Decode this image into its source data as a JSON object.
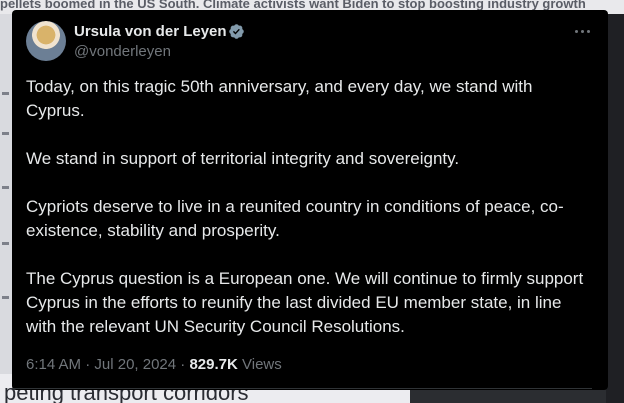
{
  "background": {
    "headline": "pellets boomed in the US South. Climate activists want Biden to stop boosting industry growth",
    "bottom_text": "peting transport corridors"
  },
  "tweet": {
    "author": {
      "name": "Ursula von der Leyen",
      "handle": "@vonderleyen",
      "verified": true
    },
    "paragraphs": [
      "Today, on this tragic 50th anniversary, and every day, we stand with Cyprus.",
      "We stand in support of territorial integrity and sovereignty.",
      "Cypriots deserve to live in a reunited country in conditions of peace, co-existence, stability and prosperity.",
      "The Cyprus question is a European one. We will continue to firmly support Cyprus in the efforts to reunify the last divided EU member state, in line with the relevant UN Security Council Resolutions."
    ],
    "time": "6:14 AM",
    "date": "Jul 20, 2024",
    "separator": "·",
    "views_count": "829.7K",
    "views_label": "Views"
  },
  "colors": {
    "card_background": "#000000",
    "primary_text": "#e7e9ea",
    "secondary_text": "#71767b",
    "verified_badge": "#829aab"
  },
  "icons": {
    "verified": "verified-badge-icon",
    "more": "more-options-icon"
  }
}
